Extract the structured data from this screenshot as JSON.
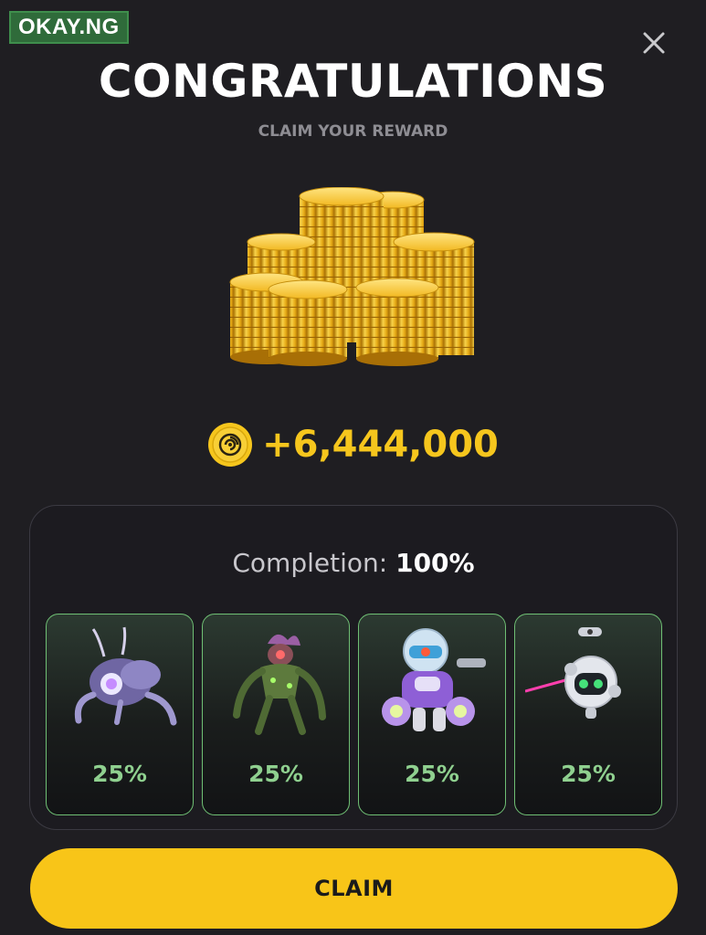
{
  "watermark": {
    "text": "OKAY.NG"
  },
  "header": {
    "title": "CONGRATULATIONS",
    "subtitle": "CLAIM YOUR REWARD"
  },
  "reward": {
    "amount": "+6,444,000",
    "coin_icon": "coin-swirl-icon",
    "art_icon": "coin-stacks-icon"
  },
  "completion": {
    "label": "Completion:",
    "value": "100%"
  },
  "cards": [
    {
      "art": "mech-spider-icon",
      "percent": "25%"
    },
    {
      "art": "mutant-creature-icon",
      "percent": "25%"
    },
    {
      "art": "robot-astronaut-icon",
      "percent": "25%"
    },
    {
      "art": "drone-orb-icon",
      "percent": "25%"
    }
  ],
  "claim": {
    "label": "CLAIM"
  },
  "colors": {
    "background": "#1f1e22",
    "accent": "#f8c518",
    "reward_text": "#f6c61d",
    "card_border": "#6fbf74",
    "card_percent": "#8fd08f"
  }
}
